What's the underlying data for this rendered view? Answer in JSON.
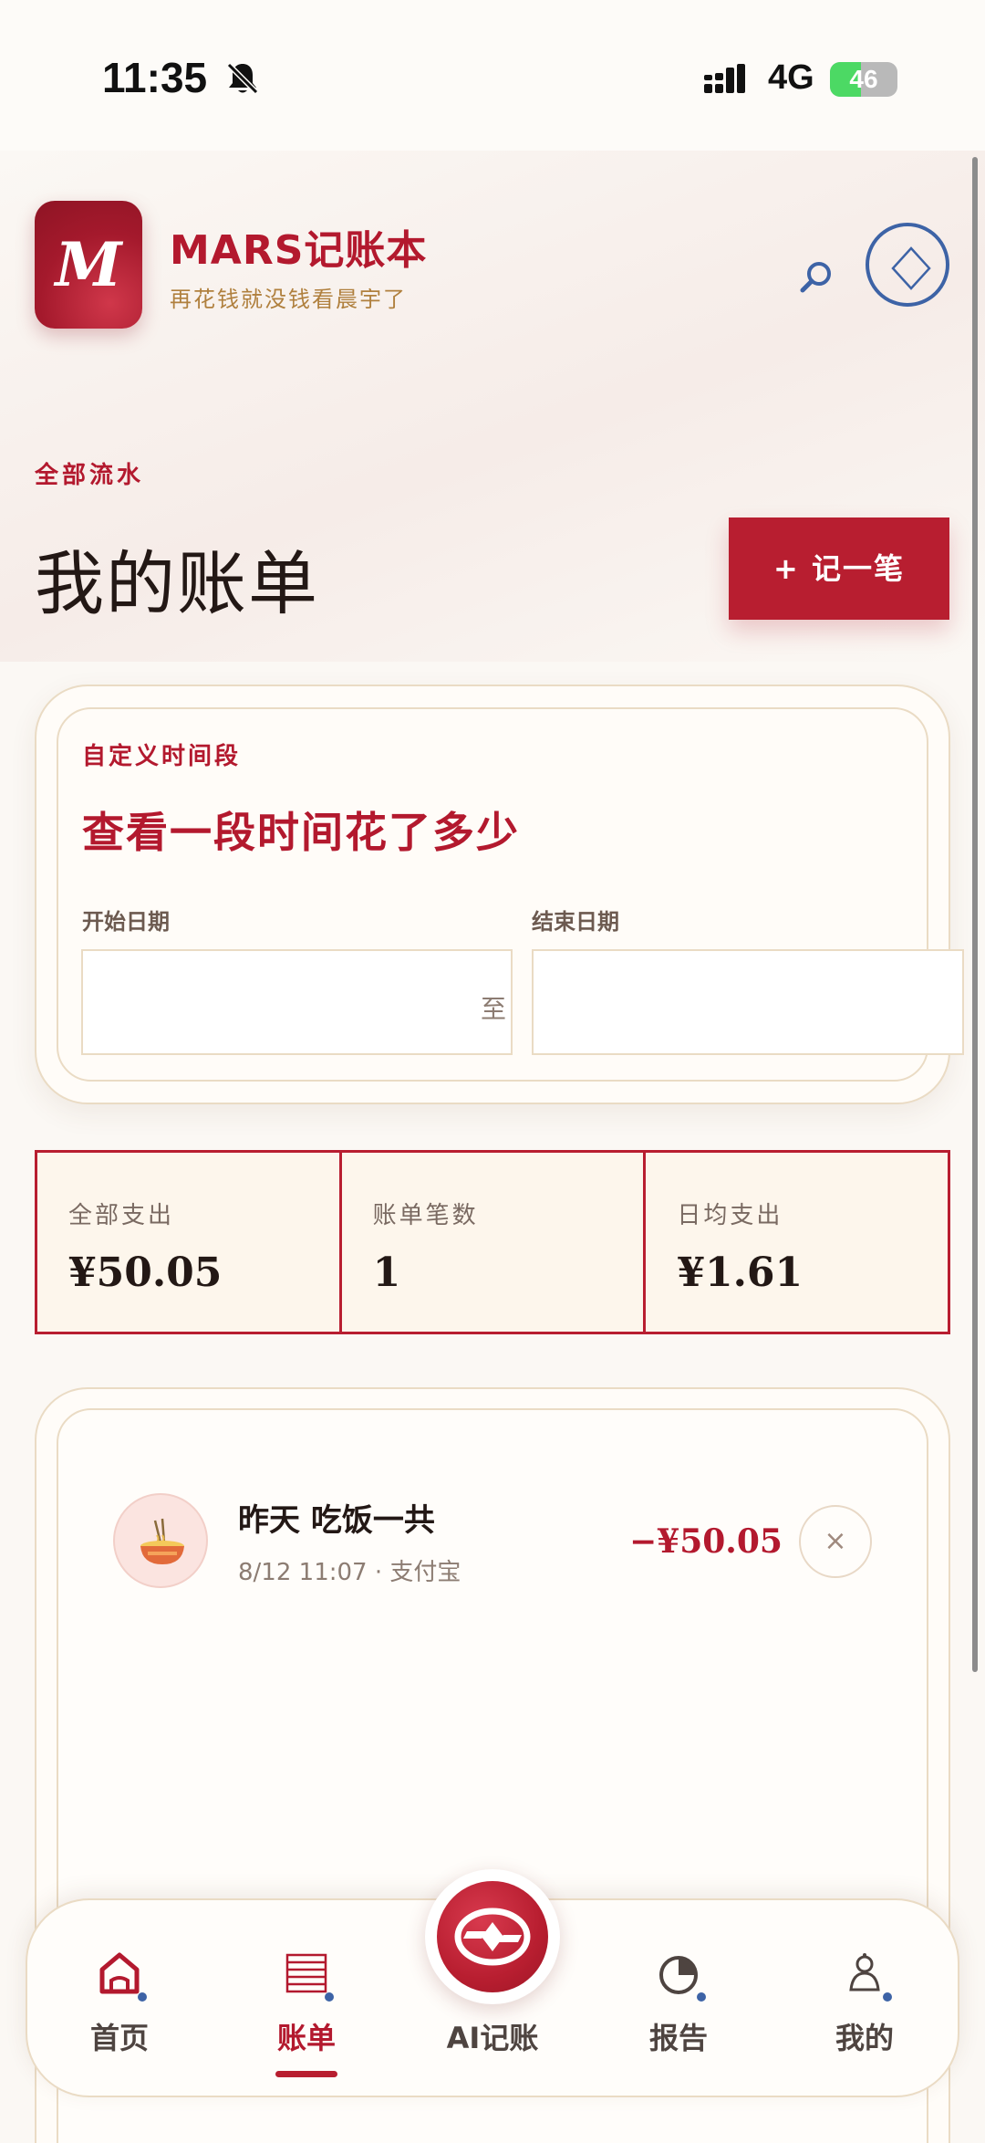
{
  "status_bar": {
    "time": "11:35",
    "network": "4G",
    "battery_level": "46",
    "battery_fraction": 0.46,
    "icons": [
      "bell-muted-icon",
      "signal-icon"
    ]
  },
  "header": {
    "logo_letter": "M",
    "app_name": "MARS记账本",
    "slogan": "再花钱就没钱看晨宇了",
    "icons": [
      "search-icon",
      "diamond-icon"
    ]
  },
  "page": {
    "kicker": "全部流水",
    "title": "我的账单",
    "add_button_label": "+ 记一笔"
  },
  "date_range": {
    "kicker": "自定义时间段",
    "title": "查看一段时间花了多少",
    "start_label": "开始日期",
    "end_label": "结束日期",
    "start_value": "",
    "end_value": "",
    "separator": "至"
  },
  "stats": [
    {
      "label": "全部支出",
      "value": "¥50.05"
    },
    {
      "label": "账单笔数",
      "value": "1"
    },
    {
      "label": "日均支出",
      "value": "¥1.61"
    }
  ],
  "transactions": [
    {
      "icon": "noodle-bowl-icon",
      "title": "昨天 吃饭一共",
      "meta": "8/12 11:07 · 支付宝",
      "amount": "−¥50.05",
      "delete_label": "×"
    }
  ],
  "tabbar": {
    "items": [
      {
        "label": "首页",
        "icon": "home-icon"
      },
      {
        "label": "账单",
        "icon": "bill-list-icon",
        "active": true
      },
      {
        "label": "AI记账",
        "icon": "ai-logo-icon"
      },
      {
        "label": "报告",
        "icon": "pie-chart-icon"
      },
      {
        "label": "我的",
        "icon": "user-icon"
      }
    ]
  },
  "colors": {
    "brand_red": "#b81e30",
    "gold": "#b0803e",
    "accent_blue": "#3d63a6",
    "background": "#fbf8f4"
  }
}
